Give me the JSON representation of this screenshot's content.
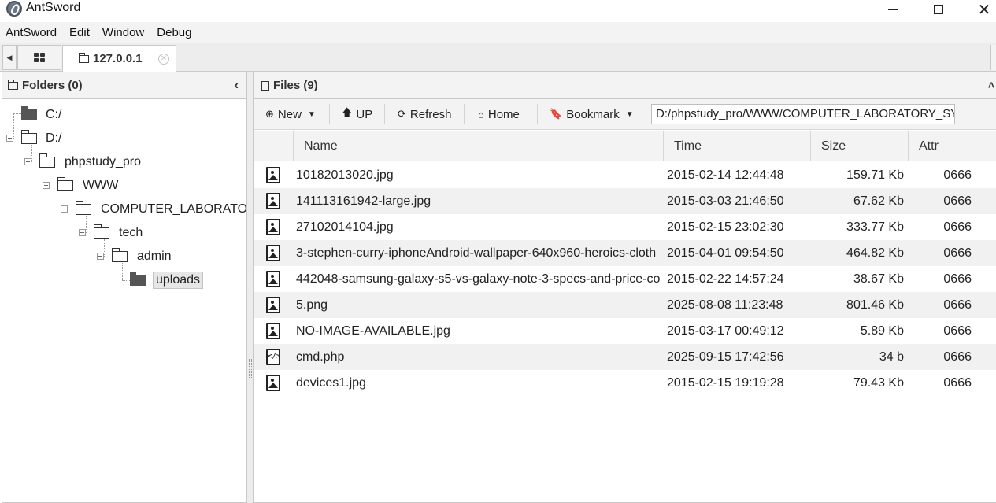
{
  "window": {
    "title": "AntSword"
  },
  "menu": [
    "AntSword",
    "Edit",
    "Window",
    "Debug"
  ],
  "tabs": {
    "active": "127.0.0.1"
  },
  "folders": {
    "title": "Folders (0)",
    "tree": [
      "C:/",
      "D:/",
      "phpstudy_pro",
      "WWW",
      "COMPUTER_LABORATORY",
      "tech",
      "admin",
      "uploads"
    ]
  },
  "files": {
    "title": "Files (9)",
    "toolbar": {
      "new": "New",
      "up": "UP",
      "refresh": "Refresh",
      "home": "Home",
      "bookmark": "Bookmark"
    },
    "path": "D:/phpstudy_pro/WWW/COMPUTER_LABORATORY_SYS",
    "columns": {
      "name": "Name",
      "time": "Time",
      "size": "Size",
      "attr": "Attr"
    },
    "rows": [
      {
        "icon": "image-icon",
        "name": "10182013020.jpg",
        "time": "2015-02-14 12:44:48",
        "size": "159.71 Kb",
        "attr": "0666"
      },
      {
        "icon": "image-icon",
        "name": "141113161942-large.jpg",
        "time": "2015-03-03 21:46:50",
        "size": "67.62 Kb",
        "attr": "0666"
      },
      {
        "icon": "image-icon",
        "name": "27102014104.jpg",
        "time": "2015-02-15 23:02:30",
        "size": "333.77 Kb",
        "attr": "0666"
      },
      {
        "icon": "image-icon",
        "name": "3-stephen-curry-iphoneAndroid-wallpaper-640x960-heroics-cloth",
        "time": "2015-04-01 09:54:50",
        "size": "464.82 Kb",
        "attr": "0666"
      },
      {
        "icon": "image-icon",
        "name": "442048-samsung-galaxy-s5-vs-galaxy-note-3-specs-and-price-co",
        "time": "2015-02-22 14:57:24",
        "size": "38.67 Kb",
        "attr": "0666"
      },
      {
        "icon": "image-icon",
        "name": "5.png",
        "time": "2025-08-08 11:23:48",
        "size": "801.46 Kb",
        "attr": "0666"
      },
      {
        "icon": "image-icon",
        "name": "NO-IMAGE-AVAILABLE.jpg",
        "time": "2015-03-17 00:49:12",
        "size": "5.89 Kb",
        "attr": "0666"
      },
      {
        "icon": "code-file-icon",
        "name": "cmd.php",
        "time": "2025-09-15 17:42:56",
        "size": "34 b",
        "attr": "0666"
      },
      {
        "icon": "image-icon",
        "name": "devices1.jpg",
        "time": "2015-02-15 19:19:28",
        "size": "79.43 Kb",
        "attr": "0666"
      }
    ]
  }
}
